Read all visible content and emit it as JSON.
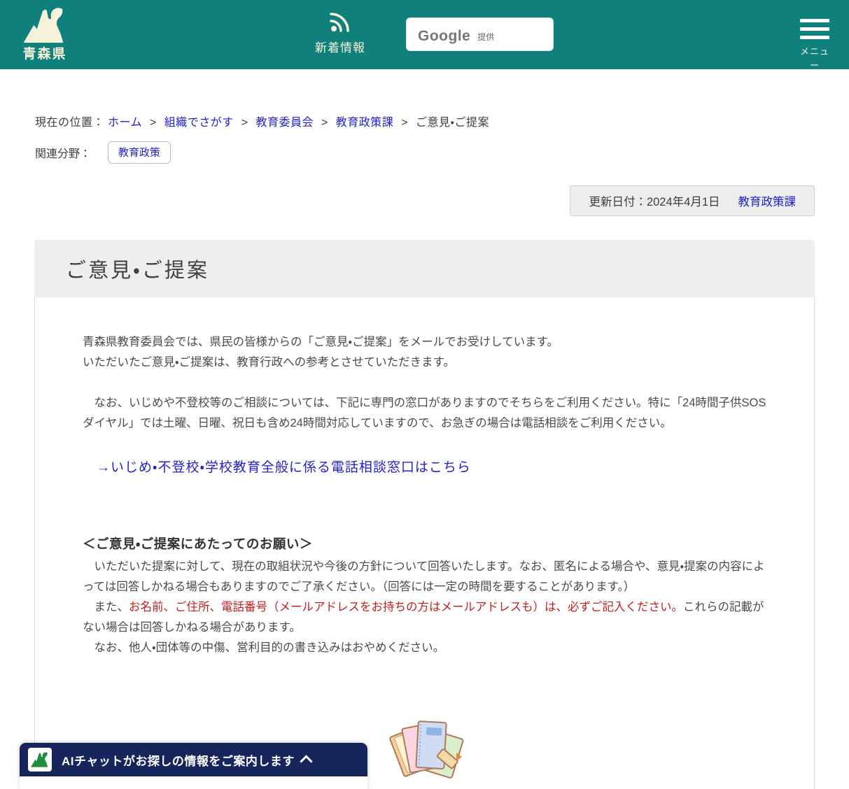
{
  "header": {
    "logo_text": "青森県",
    "news_label": "新着情報",
    "search_google": "Google",
    "search_teikyo": "提供",
    "menu_label": "メニュー"
  },
  "breadcrumb": {
    "prefix": "現在の位置：",
    "separator": ">",
    "items": [
      {
        "label": "ホーム"
      },
      {
        "label": "組織でさがす"
      },
      {
        "label": "教育委員会"
      },
      {
        "label": "教育政策課"
      },
      {
        "label": "ご意見・ご提案"
      }
    ]
  },
  "related": {
    "label": "関連分野：",
    "badge": "教育政策"
  },
  "update_box": {
    "date": "更新日付：2024年4月1日",
    "department": "教育政策課"
  },
  "page": {
    "title": "ご意見・ご提案"
  },
  "content": {
    "p1_line1": "青森県教育委員会では、県民の皆様からの「ご意見・ご提案」をメールでお受けしています。",
    "p1_line2": "いただいたご意見・ご提案は、教育行政への参考とさせていただきます。",
    "p2": "　なお、いじめや不登校等のご相談については、下記に専門の窓口がありますのでそちらをご利用ください。特に「24時間子供SOSダイヤル」では土曜、日曜、祝日も含め24時間対応していますので、お急ぎの場合は電話相談をご利用ください。",
    "main_link": "→いじめ・不登校・学校教育全般に係る電話相談窓口はこちら",
    "section_heading": "＜ご意見・ご提案にあたってのお願い＞",
    "p3": "　いただいた提案に対して、現在の取組状況や今後の方針について回答いたします。なお、匿名による場合や、意見・提案の内容によっては回答しかねる場合もありますのでご了承ください。（回答には一定の時間を要することがあります。）",
    "p4_pre": "　また、",
    "p4_red": "お名前、ご住所、電話番号（メールアドレスをお持ちの方はメールアドレスも）は、必ずご記入ください。",
    "p4_post": "これらの記載がない場合は回答しかねる場合があります。",
    "p5": "　なお、他人・団体等の中傷、営利目的の書き込みはおやめください。"
  },
  "chat_banner": {
    "label": "AIチャットがお探しの情報をご案内します"
  },
  "colors": {
    "header_teal": "#10807c",
    "logo_cream": "#f6f3da",
    "link_blue": "#2222cc",
    "alert_red": "#c21f1f",
    "banner_navy": "#16265c",
    "banner_logo_green": "#1f8f3c",
    "title_bg_gray": "#efeeee",
    "update_bg_gray": "#ededed"
  }
}
